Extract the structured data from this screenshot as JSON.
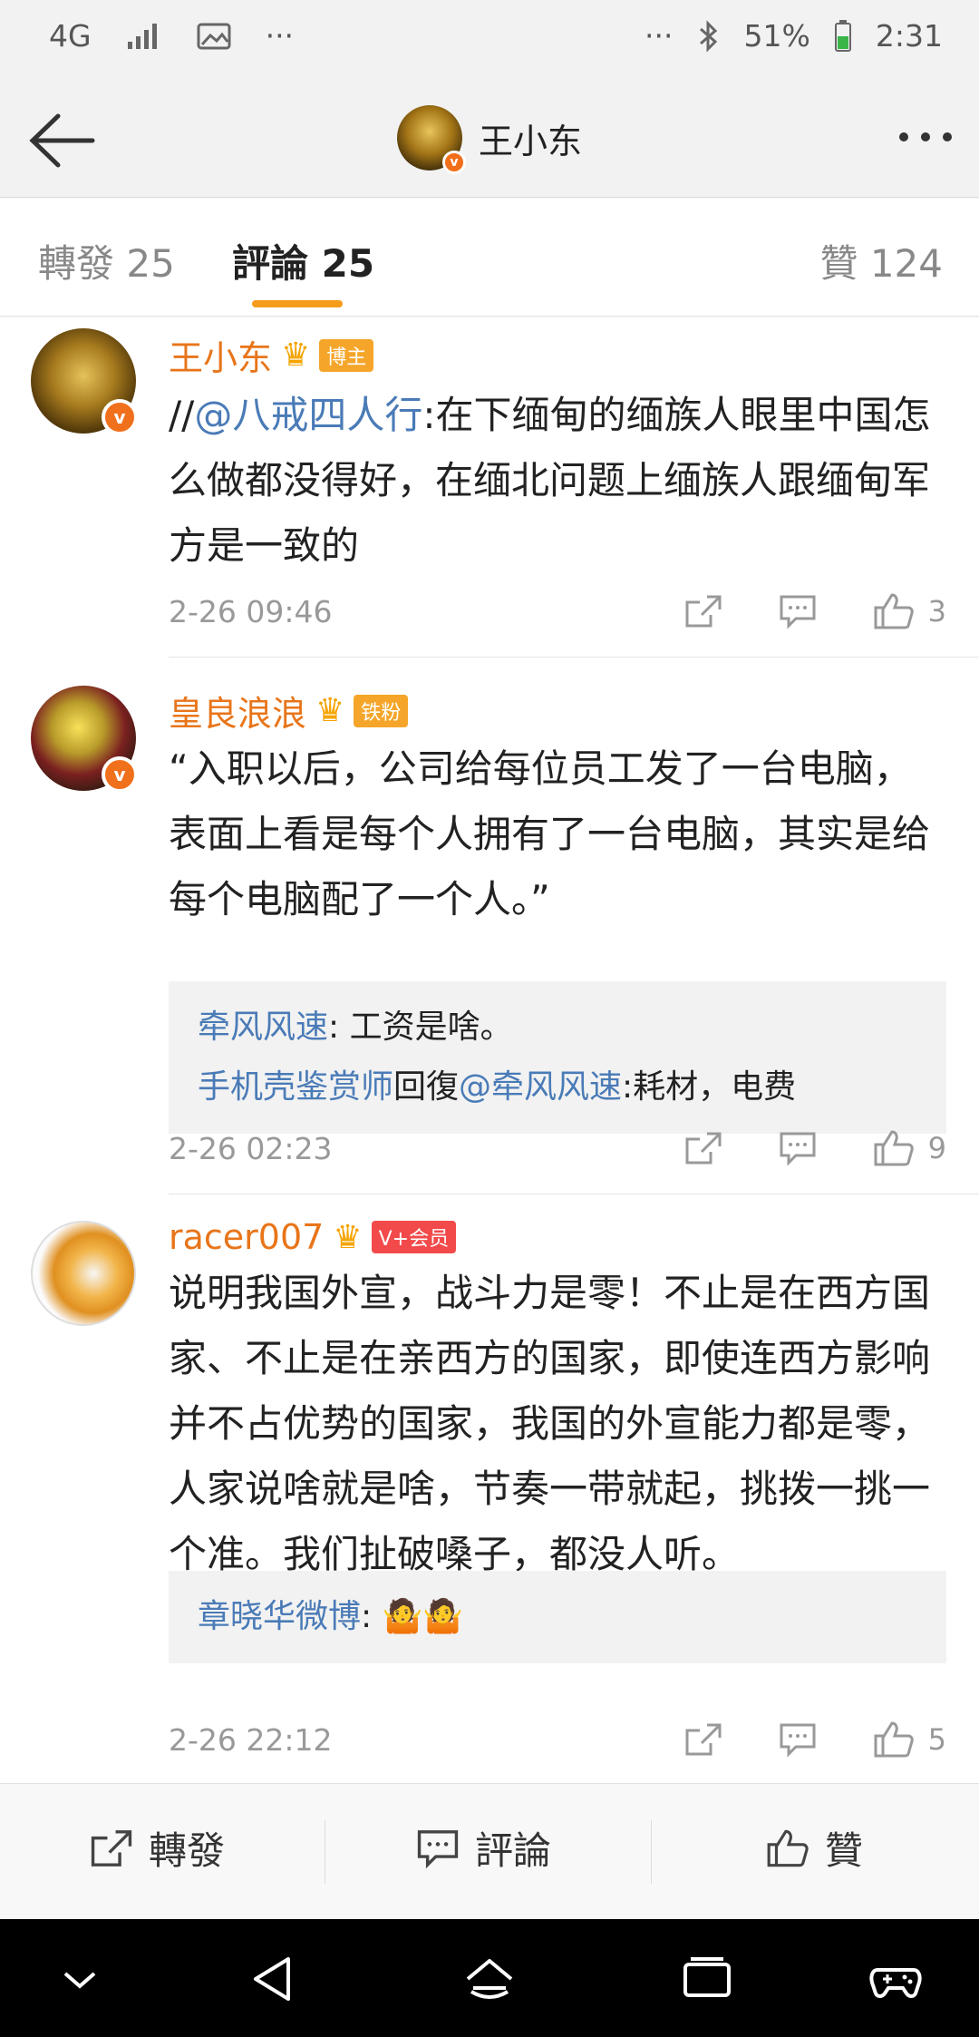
{
  "status_bar": {
    "network": "4G",
    "dots_left": "···",
    "dots_right": "···",
    "battery": "51%",
    "time": "2:31"
  },
  "header": {
    "title": "王小东"
  },
  "tabs": [
    {
      "label": "轉發 25"
    },
    {
      "label": "評論 25"
    },
    {
      "label": "贊 124"
    }
  ],
  "comments": [
    {
      "user": "王小东",
      "badge": "博主",
      "mention": "@八戒四人行",
      "prefix": "//",
      "text_after_mention": ":在下缅甸的缅族人眼里中国怎么做都没得好，在缅北问题上缅族人跟缅甸军方是一致的",
      "time": "2-26 09:46",
      "likes": "3"
    },
    {
      "user": "皇良浪浪",
      "badge": "铁粉",
      "text": "“入职以后，公司给每位员工发了一台电脑，表面上看是每个人拥有了一台电脑，其实是给每个电脑配了一个人。”",
      "replies": [
        {
          "user": "牵风风速",
          "sep": ": ",
          "text": "工资是啥。"
        },
        {
          "user": "手机壳鉴赏师",
          "reply_word": "回復",
          "mention": "@牵风风速",
          "text": ":耗材，电费"
        }
      ],
      "time": "2-26 02:23",
      "likes": "9"
    },
    {
      "user": "racer007",
      "badge": "V+会员",
      "text": "说明我国外宣，战斗力是零！不止是在西方国家、不止是在亲西方的国家，即使连西方影响并不占优势的国家，我国的外宣能力都是零，人家说啥就是啥，节奏一带就起，挑拨一挑一个准。我们扯破嗓子，都没人听。",
      "replies": [
        {
          "user": "章晓华微博",
          "sep": ": ",
          "text": "🤷🤷"
        }
      ],
      "time": "2-26 22:12",
      "likes": "5"
    }
  ],
  "bottom_bar": {
    "repost": "轉發",
    "comment": "評論",
    "like": "贊"
  },
  "colors": {
    "accent": "#f59c1a",
    "username": "#e8751a",
    "mention": "#4a7bb7"
  }
}
